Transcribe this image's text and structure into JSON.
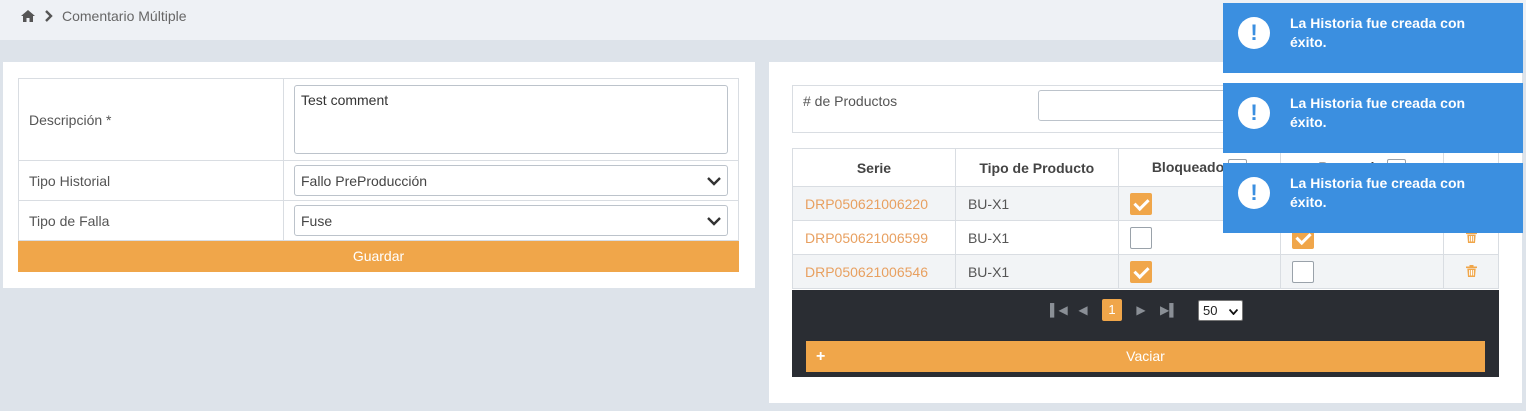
{
  "breadcrumb": {
    "page": "Comentario Múltiple"
  },
  "form": {
    "descripcion_label": "Descripción *",
    "descripcion_value": "Test comment",
    "tipo_historial_label": "Tipo Historial",
    "tipo_historial_value": "Fallo PreProducción",
    "tipo_falla_label": "Tipo de Falla",
    "tipo_falla_value": "Fuse",
    "save_label": "Guardar"
  },
  "products": {
    "qty_label": "# de Productos",
    "columns": [
      "Serie",
      "Tipo de Producto",
      "Bloqueado",
      "Reparado",
      ""
    ],
    "rows": [
      {
        "serie": "DRP050621006220",
        "tipo": "BU-X1",
        "bloqueado": true,
        "reparado": false
      },
      {
        "serie": "DRP050621006599",
        "tipo": "BU-X1",
        "bloqueado": false,
        "reparado": true
      },
      {
        "serie": "DRP050621006546",
        "tipo": "BU-X1",
        "bloqueado": true,
        "reparado": false
      }
    ],
    "current_page": "1",
    "page_size": "50",
    "clear_label": "Vaciar"
  },
  "toasts": [
    {
      "message": "La Historia fue creada con éxito."
    },
    {
      "message": "La Historia fue creada con éxito."
    },
    {
      "message": "La Historia fue creada con éxito."
    }
  ],
  "colors": {
    "accent": "#f0a64a",
    "toast": "#3b8fe0",
    "pager": "#2a2d33",
    "link": "#e8a060"
  }
}
